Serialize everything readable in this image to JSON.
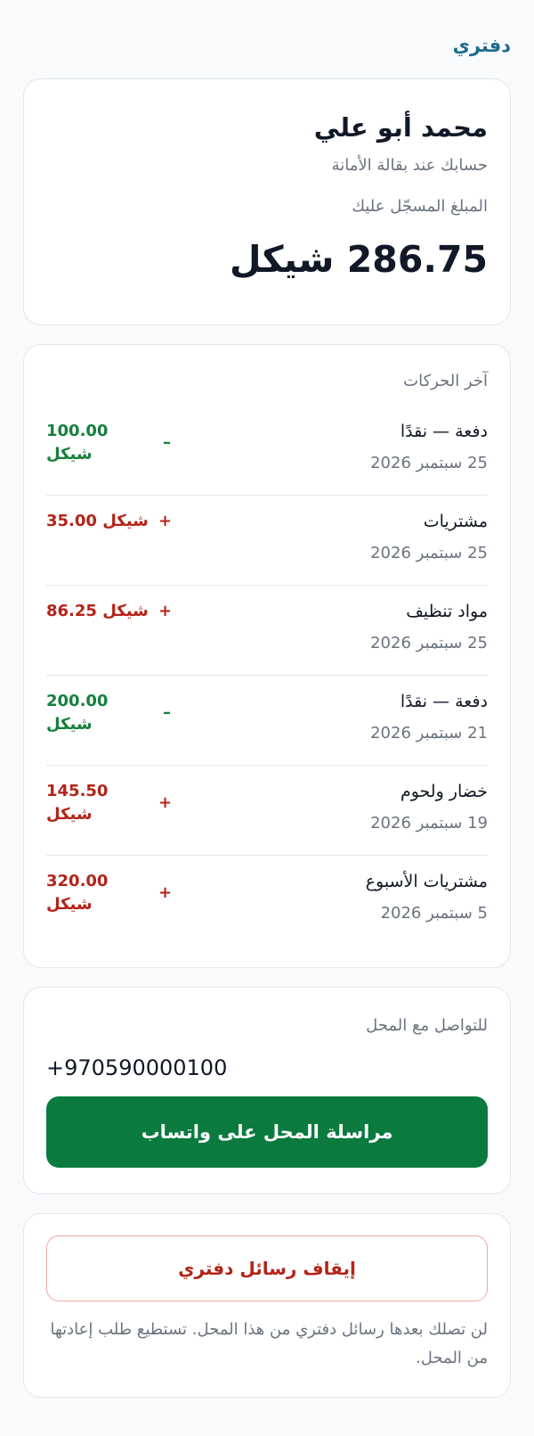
{
  "brand": "دفتري",
  "account": {
    "customer_name": "محمد أبو علي",
    "subtitle": "حسابك عند بقالة الأمانة",
    "balance_label": "المبلغ المسجّل عليك",
    "balance_value": "286.75",
    "balance_currency": "شيكل"
  },
  "transactions": {
    "title": "آخر الحركات",
    "items": [
      {
        "desc": "دفعة — نقدًا",
        "date": "25 سبتمبر 2026",
        "sign": "–",
        "amount": "100.00 شيكل",
        "kind": "credit"
      },
      {
        "desc": "مشتريات",
        "date": "25 سبتمبر 2026",
        "sign": "+",
        "amount": "35.00 شيكل",
        "kind": "debit"
      },
      {
        "desc": "مواد تنظيف",
        "date": "25 سبتمبر 2026",
        "sign": "+",
        "amount": "86.25 شيكل",
        "kind": "debit"
      },
      {
        "desc": "دفعة — نقدًا",
        "date": "21 سبتمبر 2026",
        "sign": "–",
        "amount": "200.00 شيكل",
        "kind": "credit"
      },
      {
        "desc": "خضار ولحوم",
        "date": "19 سبتمبر 2026",
        "sign": "+",
        "amount": "145.50 شيكل",
        "kind": "debit"
      },
      {
        "desc": "مشتريات الأسبوع",
        "date": "5 سبتمبر 2026",
        "sign": "+",
        "amount": "320.00 شيكل",
        "kind": "debit"
      }
    ]
  },
  "contact": {
    "title": "للتواصل مع المحل",
    "phone": "+970590000100",
    "whatsapp_label": "مراسلة المحل على واتساب"
  },
  "stop": {
    "button_label": "إيقاف رسائل دفتري",
    "note": "لن تصلك بعدها رسائل دفتري من هذا المحل. تستطيع طلب إعادتها من المحل."
  },
  "colors": {
    "brand": "#1e6b8e",
    "credit": "#15803d",
    "debit": "#b42318",
    "whatsapp": "#0b7a3f"
  }
}
